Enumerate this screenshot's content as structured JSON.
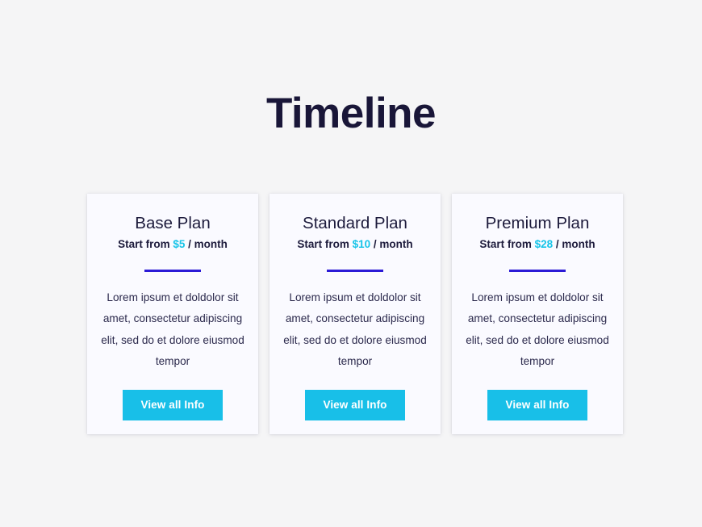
{
  "page": {
    "title": "Timeline",
    "background_color": "#f5f5f6",
    "title_color": "#191638"
  },
  "theme": {
    "accent_cyan": "#17c4e8",
    "divider_indigo": "#2b1ad6",
    "button_bg": "#18bfe8",
    "button_text": "#ffffff",
    "card_bg": "#fafaff",
    "text_dark": "#1d1b3c"
  },
  "plans": [
    {
      "name": "Base Plan",
      "price_prefix": "Start from ",
      "price_amount": "$5",
      "price_suffix": " / month",
      "description": "Lorem ipsum et doldolor sit amet, consectetur adipiscing elit, sed do et dolore eiusmod tempor",
      "button_label": "View all Info"
    },
    {
      "name": "Standard Plan",
      "price_prefix": "Start from ",
      "price_amount": "$10",
      "price_suffix": " / month",
      "description": "Lorem ipsum et doldolor sit amet, consectetur adipiscing elit, sed do et dolore eiusmod tempor",
      "button_label": "View all Info"
    },
    {
      "name": "Premium Plan",
      "price_prefix": "Start from ",
      "price_amount": "$28",
      "price_suffix": " / month",
      "description": "Lorem ipsum et doldolor sit amet, consectetur adipiscing elit, sed do et dolore eiusmod tempor",
      "button_label": "View all Info"
    }
  ]
}
